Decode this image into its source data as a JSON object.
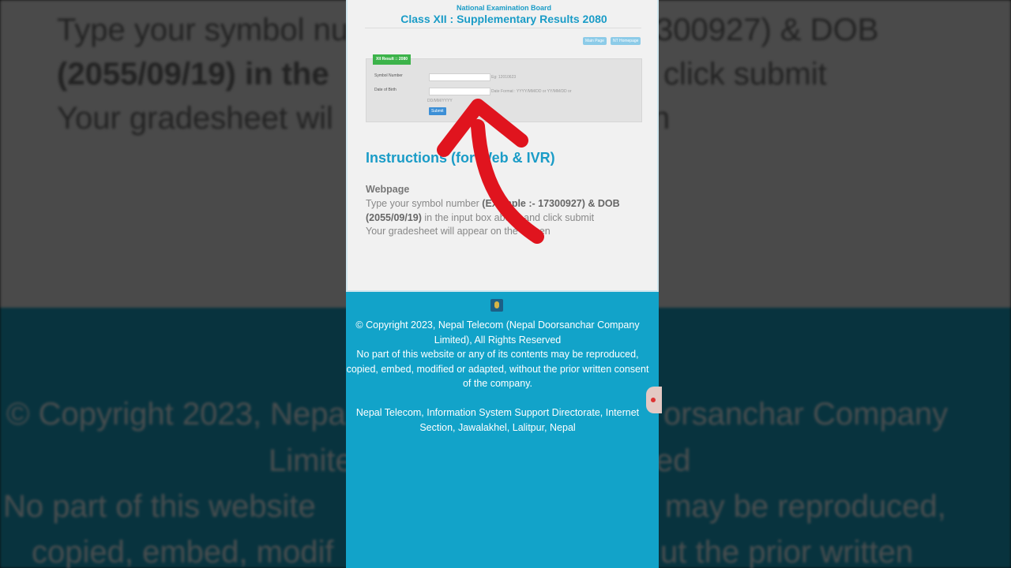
{
  "background": {
    "line1": "Type your symbol nu",
    "line1_right": "300927) & DOB",
    "line2": "(2055/09/19) in the",
    "line2_right": "click submit",
    "line3": "Your gradesheet wil",
    "line3_right": "n",
    "foot1": "© Copyright 2023, Nepa",
    "foot1_right": "orsanchar Company",
    "foot2": "Limite",
    "foot2_right": "ed",
    "foot3": "No part of this website",
    "foot3_right": "may be reproduced,",
    "foot4": "copied, embed, modif",
    "foot4_right": "ut the prior written"
  },
  "header": {
    "board": "National Examination Board",
    "title": "Class XII : Supplementary Results 2080"
  },
  "nav": {
    "main_page": "Main Page",
    "homepage": "NT Homepage"
  },
  "form": {
    "tag": "XII Result :: 2080",
    "symbol_label": "Symbol Number",
    "symbol_hint": "Eg: 12010623",
    "dob_label": "Date of Birth",
    "dob_hint": "Date Format : YYYY/MM/DD or YY/MM/DD or",
    "dob_hint2": "DD/MM/YYYY",
    "submit": "Submit"
  },
  "instructions": {
    "title": "Instructions (for Web & IVR)",
    "webpage_heading": "Webpage",
    "p1_start": "Type your symbol number ",
    "p1_bold": "(Example :- 17300927) & DOB (2055/09/19)",
    "p1_end": " in the input box above and click submit",
    "p2": "Your gradesheet will appear on the screen"
  },
  "footer": {
    "copyright": "© Copyright 2023, Nepal Telecom (Nepal Doorsanchar Company Limited), All Rights Reserved",
    "notice": "No part of this website or any of its contents may be reproduced, copied, embed, modified or adapted, without the prior written consent of the company.",
    "address": "Nepal Telecom, Information System Support Directorate, Internet Section, Jawalakhel, Lalitpur, Nepal"
  },
  "colors": {
    "accent": "#1a9cc7",
    "footer_bg": "#12a3c9",
    "arrow": "#e0141e",
    "tag": "#3cb34a"
  }
}
